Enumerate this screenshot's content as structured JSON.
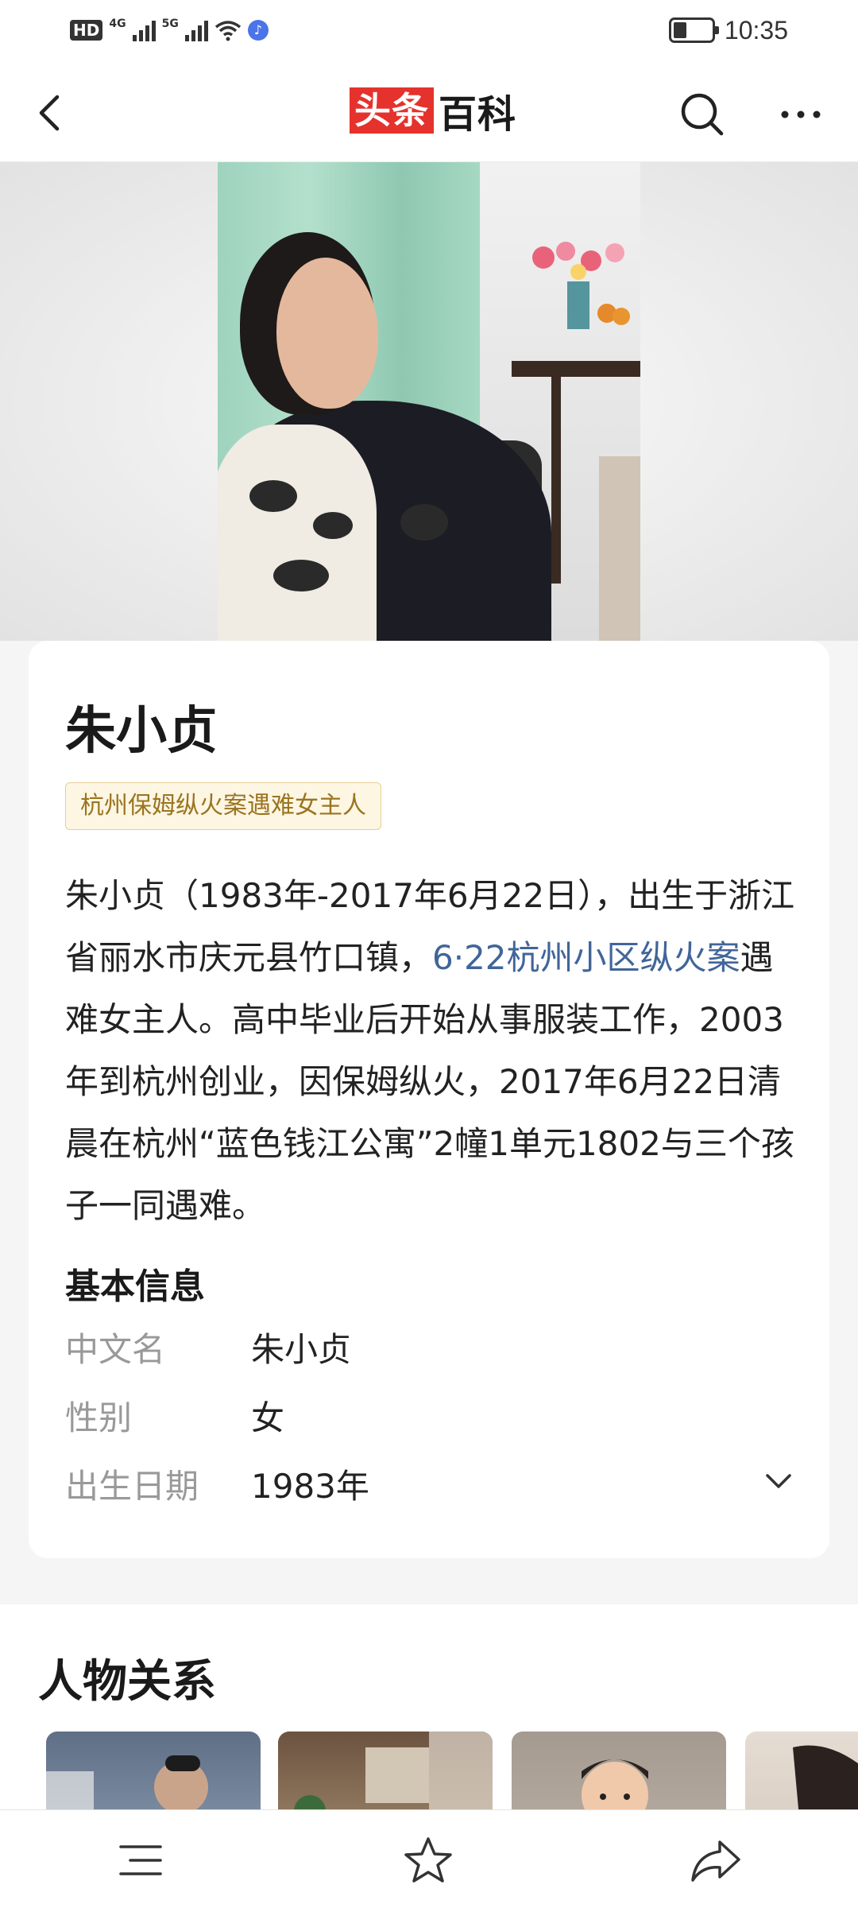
{
  "status_bar": {
    "hd": "HD",
    "sim1_net": "4G",
    "sim2_net": "5G",
    "time": "10:35",
    "battery_level": 0.35,
    "icons": [
      "hd-icon",
      "signal-icon",
      "wifi-icon",
      "music-icon",
      "battery-icon"
    ]
  },
  "nav": {
    "logo_red": "头条",
    "logo_dark": "百科",
    "icons": [
      "back-icon",
      "search-icon",
      "more-icon"
    ]
  },
  "entry": {
    "name": "朱小贞",
    "tag": "杭州保姆纵火案遇难女主人",
    "summary_before": "朱小贞（1983年-2017年6月22日），出生于浙江省丽水市庆元县竹口镇，",
    "summary_link": "6·22杭州小区纵火案",
    "summary_after": "遇难女主人。高中毕业后开始从事服装工作，2003年到杭州创业，因保姆纵火，2017年6月22日清晨在杭州“蓝色钱江公寓”2幢1单元1802与三个孩子一同遇难。"
  },
  "basic_info": {
    "title": "基本信息",
    "rows": [
      {
        "label": "中文名",
        "value": "朱小贞"
      },
      {
        "label": "性别",
        "value": "女"
      },
      {
        "label": "出生日期",
        "value": "1983年"
      }
    ]
  },
  "relations": {
    "title": "人物关系"
  },
  "bottom_bar": {
    "icons": [
      "menu-icon",
      "star-icon",
      "share-icon"
    ]
  }
}
